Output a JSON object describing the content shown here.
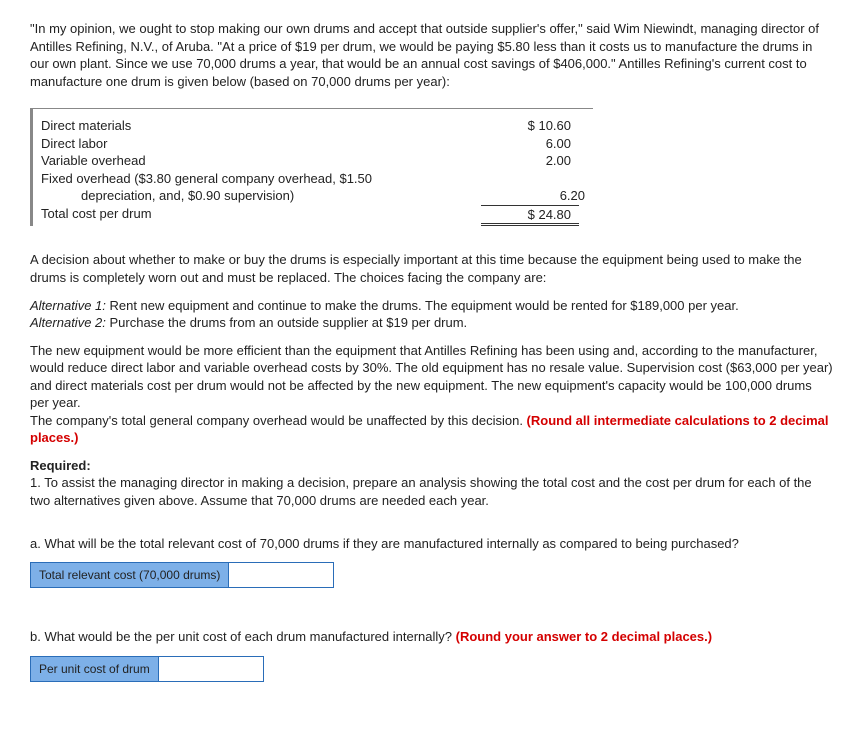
{
  "intro": "\"In my opinion, we ought to stop making our own drums and accept that outside supplier's offer,\" said Wim Niewindt, managing director of Antilles Refining, N.V., of Aruba. \"At a price of $19 per drum, we would be paying $5.80 less than it costs us to manufacture the drums in our own plant. Since we use 70,000 drums a year, that would be an annual cost savings of $406,000.\" Antilles Refining's current cost to manufacture one drum is given below (based on 70,000 drums per year):",
  "costs": {
    "dm_label": "Direct materials",
    "dm_val": "$ 10.60",
    "dl_label": "Direct labor",
    "dl_val": "6.00",
    "vo_label": "Variable overhead",
    "vo_val": "2.00",
    "fo_label1": "Fixed overhead ($3.80 general company overhead, $1.50",
    "fo_label2": "depreciation, and, $0.90 supervision)",
    "fo_val": "6.20",
    "total_label": "Total cost per drum",
    "total_val": "$ 24.80"
  },
  "decision_p1": "A decision about whether to make or buy the drums is especially important at this time because the equipment being used to make the drums is completely worn out and must be replaced. The choices facing the company are:",
  "alt1_label": "Alternative 1:",
  "alt1_text": " Rent new equipment and continue to make the drums. The equipment would be rented for $189,000 per year.",
  "alt2_label": "Alternative 2:",
  "alt2_text": " Purchase the drums from an outside supplier at $19 per drum.",
  "equip_p": "The new equipment would be more efficient than the equipment that Antilles Refining has been using and, according to the manufacturer, would reduce direct labor and variable overhead costs by 30%. The old equipment has no resale value. Supervision cost ($63,000 per year) and direct materials cost per drum would not be affected by the new equipment. The new equipment's capacity would be 100,000 drums per year.",
  "general_oh": "The company's total general company overhead would be unaffected by this decision. ",
  "round_note": "(Round all intermediate calculations to 2 decimal places.)",
  "required_label": "Required:",
  "req1": "1. To assist the managing director in making a decision, prepare an analysis showing the total cost and the cost per drum for each of the two alternatives given above. Assume that 70,000 drums are needed each year.",
  "qa_text": "a. What will be the total relevant cost of 70,000 drums if they are manufactured internally as compared to being purchased?",
  "qa_box_label": "Total relevant cost (70,000 drums)",
  "qb_text": "b. What would be the per unit cost of each drum manufactured internally? ",
  "qb_round": "(Round your answer to 2 decimal places.)",
  "qb_box_label": "Per unit cost of drum"
}
